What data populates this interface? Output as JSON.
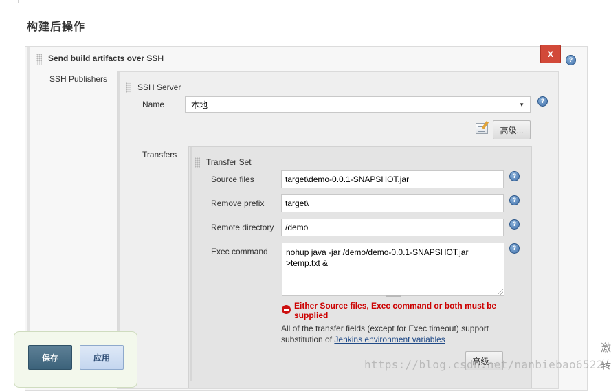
{
  "section": {
    "title": "构建后操作"
  },
  "step": {
    "title": "Send build artifacts over SSH",
    "delete_label": "X",
    "help": "?"
  },
  "publishers": {
    "label": "SSH Publishers",
    "server": {
      "title": "SSH Server",
      "name_label": "Name",
      "name_value": "本地",
      "advanced_label": "高级...",
      "transfers_label": "Transfers"
    }
  },
  "transfer_set": {
    "title": "Transfer Set",
    "fields": {
      "source_files_label": "Source files",
      "source_files_value": "target\\demo-0.0.1-SNAPSHOT.jar",
      "remove_prefix_label": "Remove prefix",
      "remove_prefix_value": "target\\",
      "remote_directory_label": "Remote directory",
      "remote_directory_value": "/demo",
      "exec_command_label": "Exec command",
      "exec_command_value": "nohup java -jar /demo/demo-0.0.1-SNAPSHOT.jar\n>temp.txt &"
    },
    "error": "Either Source files, Exec command or both must be supplied",
    "hint_prefix": "All of the transfer fields (except for Exec timeout) support substitution of ",
    "hint_link": "Jenkins environment variables",
    "advanced_label": "高级..."
  },
  "actions": {
    "save_label": "保存",
    "apply_label": "应用"
  },
  "watermark": {
    "url": "https://blog.csdn.net/nanbiebao6522",
    "side_text": "激\n转"
  },
  "colors": {
    "delete_red": "#d24939",
    "save_blue": "#4a6f87",
    "apply_blue": "#c9daf1",
    "error_red": "#cc0000",
    "link_blue": "#204a87"
  }
}
